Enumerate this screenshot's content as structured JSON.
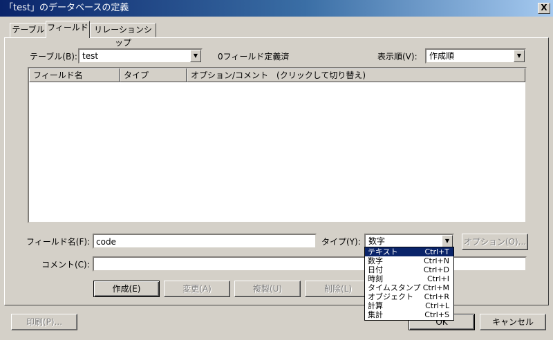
{
  "window": {
    "title": "「test」のデータベースの定義",
    "close_label": "X"
  },
  "tabs": [
    {
      "label": "テーブル"
    },
    {
      "label": "フィールド"
    },
    {
      "label": "リレーションシップ"
    }
  ],
  "table_select": {
    "label": "テーブル(B):",
    "value": "test"
  },
  "field_count_text": "0フィールド定義済",
  "sort_order": {
    "label": "表示順(V):",
    "value": "作成順"
  },
  "list_columns": [
    "フィールド名",
    "タイプ",
    "オプション/コメント　(クリックして切り替え)"
  ],
  "field_name": {
    "label": "フィールド名(F):",
    "value": "code"
  },
  "type_select": {
    "label": "タイプ(Y):",
    "value": "数字"
  },
  "options_button": "オプション(O)...",
  "comment": {
    "label": "コメント(C):",
    "value": ""
  },
  "buttons": {
    "create": "作成(E)",
    "change": "変更(A)",
    "duplicate": "複製(U)",
    "delete": "削除(L)",
    "print": "印刷(P)...",
    "ok": "OK",
    "cancel": "キャンセル"
  },
  "type_options": [
    {
      "name": "テキスト",
      "shortcut": "Ctrl+T"
    },
    {
      "name": "数字",
      "shortcut": "Ctrl+N"
    },
    {
      "name": "日付",
      "shortcut": "Ctrl+D"
    },
    {
      "name": "時刻",
      "shortcut": "Ctrl+I"
    },
    {
      "name": "タイムスタンプ",
      "shortcut": "Ctrl+M"
    },
    {
      "name": "オブジェクト",
      "shortcut": "Ctrl+R"
    },
    {
      "name": "計算",
      "shortcut": "Ctrl+L"
    },
    {
      "name": "集計",
      "shortcut": "Ctrl+S"
    }
  ],
  "colors": {
    "titlebar": "#0a246a",
    "face": "#d4d0c8",
    "highlight": "#0a246a"
  }
}
